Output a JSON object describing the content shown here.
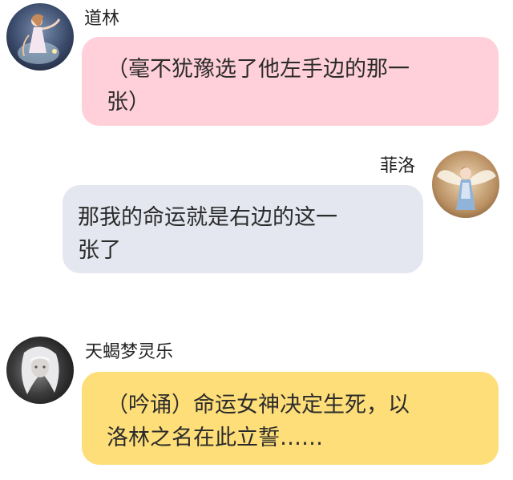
{
  "messages": [
    {
      "sender": "道林",
      "side": "left",
      "avatar": "fairy-portrait-dark",
      "bubble_color": "#ffd0da",
      "line1": "（毫不犹豫选了他左手边的那一",
      "line2": "张）"
    },
    {
      "sender": "菲洛",
      "side": "right",
      "avatar": "winged-angel-portrait",
      "bubble_color": "#e4e7ef",
      "line1": "那我的命运就是右边的这一",
      "line2": "张了"
    },
    {
      "sender": "天蝎梦灵乐",
      "side": "left",
      "avatar": "white-haired-portrait",
      "bubble_color": "#fede79",
      "line1": "（吟诵）命运女神决定生死，以",
      "line2": "洛林之名在此立誓……"
    }
  ]
}
